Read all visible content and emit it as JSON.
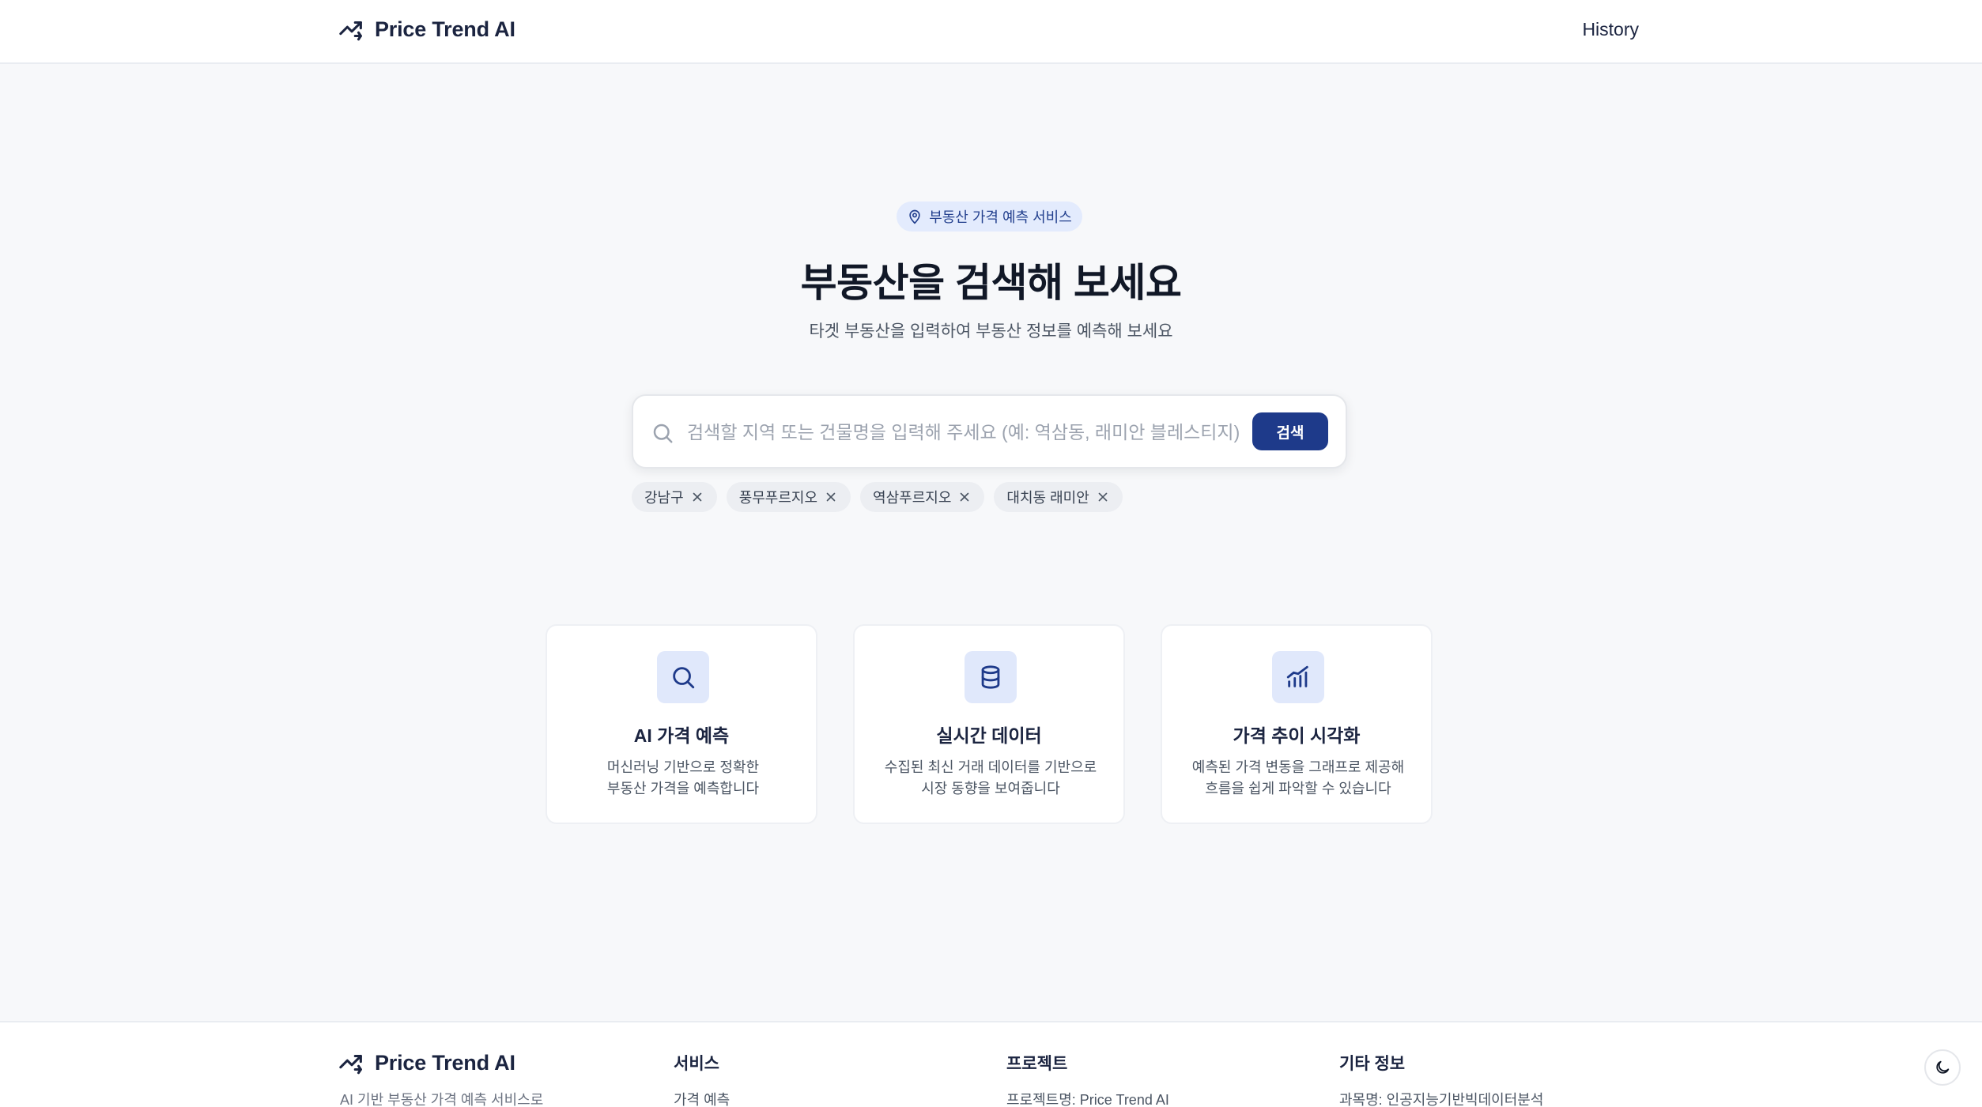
{
  "header": {
    "logo_text": "Price Trend AI",
    "logo_icon": "trending-up-icon",
    "nav_history": "History"
  },
  "hero": {
    "badge_label": "부동산 가격 예측 서비스",
    "badge_icon": "map-pin-icon",
    "title": "부동산을 검색해 보세요",
    "subtitle": "타겟 부동산을 입력하여 부동산 정보를 예측해 보세요"
  },
  "search": {
    "placeholder": "검색할 지역 또는 건물명을 입력해 주세요 (예: 역삼동, 래미안 블레스티지)",
    "value": "",
    "button_label": "검색"
  },
  "recent_searches": [
    "강남구",
    "풍무푸르지오",
    "역삼푸르지오",
    "대치동 래미안"
  ],
  "features": [
    {
      "icon": "search-icon",
      "title": "AI 가격 예측",
      "desc_line1": "머신러닝 기반으로 정확한",
      "desc_line2": "부동산 가격을 예측합니다"
    },
    {
      "icon": "database-icon",
      "title": "실시간 데이터",
      "desc_line1": "수집된 최신 거래 데이터를 기반으로",
      "desc_line2": "시장 동향을 보여줍니다"
    },
    {
      "icon": "bar-chart-icon",
      "title": "가격 추이 시각화",
      "desc_line1": "예측된 가격 변동을 그래프로 제공해",
      "desc_line2": "흐름을 쉽게 파악할 수 있습니다"
    }
  ],
  "footer": {
    "logo_text": "Price Trend AI",
    "description": "AI 기반 부동산 가격 예측 서비스로",
    "columns": [
      {
        "heading": "서비스",
        "first_item": "가격 예측"
      },
      {
        "heading": "프로젝트",
        "first_item": "프로젝트명: Price Trend AI"
      },
      {
        "heading": "기타 정보",
        "first_item": "과목명: 인공지능기반빅데이터분석"
      }
    ]
  },
  "theme_toggle_icon": "moon-icon",
  "colors": {
    "primary": "#1e3a8a",
    "badge_bg": "#e3ebfd",
    "icon_tile_bg": "#e0e8fb",
    "page_bg": "#f7f8fa"
  }
}
